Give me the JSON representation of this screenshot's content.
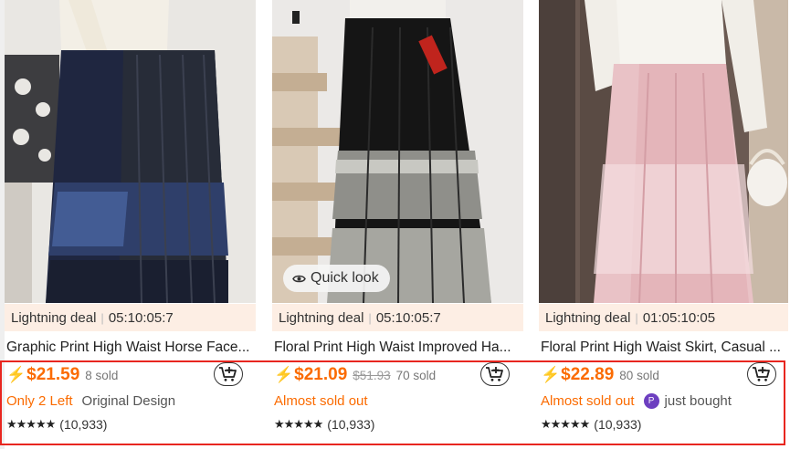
{
  "products": [
    {
      "deal_label": "Lightning deal",
      "deal_timer": "05:10:05:7",
      "title": "Graphic Print High Waist Horse Face...",
      "bolt": "⚡",
      "price": "$21.59",
      "original_price": "",
      "sold": "8 sold",
      "urgency": "Only 2 Left",
      "extra": "Original Design",
      "stars": "★★★★★",
      "reviews": "(10,933)",
      "quick_look": ""
    },
    {
      "deal_label": "Lightning deal",
      "deal_timer": "05:10:05:7",
      "title": "Floral Print High Waist Improved Ha...",
      "bolt": "⚡",
      "price": "$21.09",
      "original_price": "$51.93",
      "sold": "70 sold",
      "urgency": "Almost sold out",
      "extra": "",
      "stars": "★★★★★",
      "reviews": "(10,933)",
      "quick_look": "Quick look"
    },
    {
      "deal_label": "Lightning deal",
      "deal_timer": "01:05:10:05",
      "title": "Floral Print High Waist Skirt, Casual ...",
      "bolt": "⚡",
      "price": "$22.89",
      "original_price": "",
      "sold": "80 sold",
      "urgency": "Almost sold out",
      "avatar_letter": "P",
      "bought": "just bought",
      "stars": "★★★★★",
      "reviews": "(10,933)",
      "quick_look": ""
    }
  ],
  "colors": {
    "price": "#fb6b00",
    "deal_bg": "#fdeee4",
    "highlight_border": "#e8261f",
    "avatar": "#6d3fc0"
  },
  "icons": [
    "lightning-icon",
    "add-to-cart-icon",
    "eye-icon",
    "star-icon"
  ]
}
